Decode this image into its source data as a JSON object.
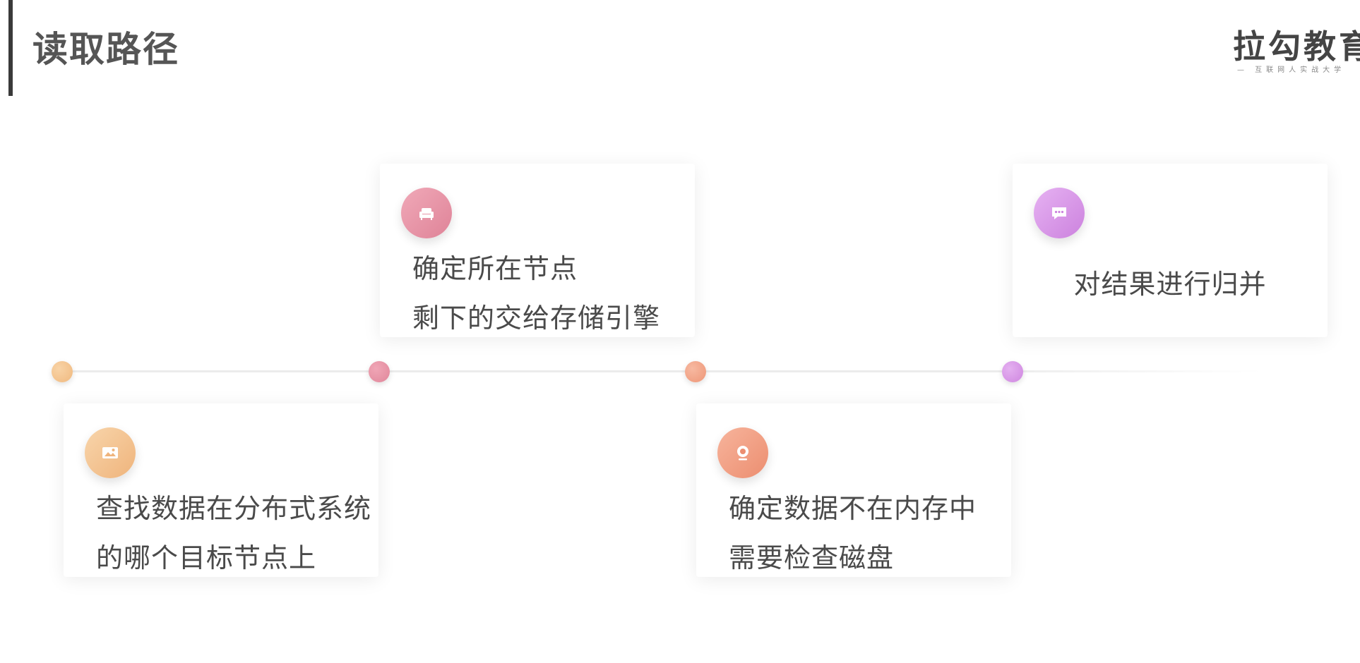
{
  "page": {
    "title": "读取路径"
  },
  "logo": {
    "text": "拉勾教育",
    "tagline": "— 互联网人实战大学"
  },
  "steps": [
    {
      "line1": "查找数据在分布式系统",
      "line2": "的哪个目标节点上",
      "icon": "image-icon",
      "color": "#f2c089"
    },
    {
      "line1": "确定所在节点",
      "line2": "剩下的交给存储引擎",
      "icon": "sofa-icon",
      "color": "#e4899c"
    },
    {
      "line1": "确定数据不在内存中",
      "line2": "需要检查磁盘",
      "icon": "webcam-icon",
      "color": "#f09a7c"
    },
    {
      "line1": "对结果进行归并",
      "line2": "",
      "icon": "chat-icon",
      "color": "#d48be2"
    }
  ]
}
